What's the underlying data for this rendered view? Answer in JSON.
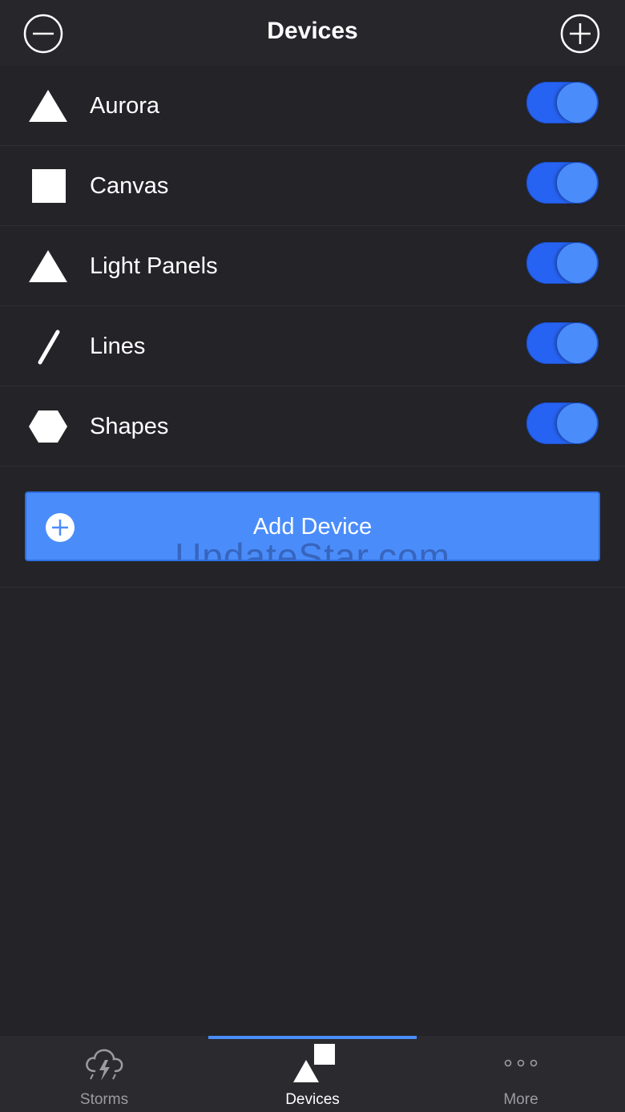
{
  "header": {
    "title": "Devices",
    "left_icon": "minus-circle-icon",
    "right_icon": "plus-circle-icon"
  },
  "devices": [
    {
      "label": "Aurora",
      "icon": "triangle-icon",
      "enabled": true
    },
    {
      "label": "Canvas",
      "icon": "square-icon",
      "enabled": true
    },
    {
      "label": "Light Panels",
      "icon": "triangle-icon",
      "enabled": true
    },
    {
      "label": "Lines",
      "icon": "line-icon",
      "enabled": true
    },
    {
      "label": "Shapes",
      "icon": "hexagon-icon",
      "enabled": true
    }
  ],
  "add_device": {
    "label": "Add Device",
    "icon": "plus-circle-icon",
    "watermark": "UpdateStar.com"
  },
  "tabs": [
    {
      "label": "Storms",
      "icon": "storm-cloud-icon",
      "active": false
    },
    {
      "label": "Devices",
      "icon": "devices-icon",
      "active": true
    },
    {
      "label": "More",
      "icon": "more-dots-icon",
      "active": false
    }
  ],
  "colors": {
    "background": "#232328",
    "accent": "#4a8dfa",
    "toggle_track": "#2663f2"
  }
}
